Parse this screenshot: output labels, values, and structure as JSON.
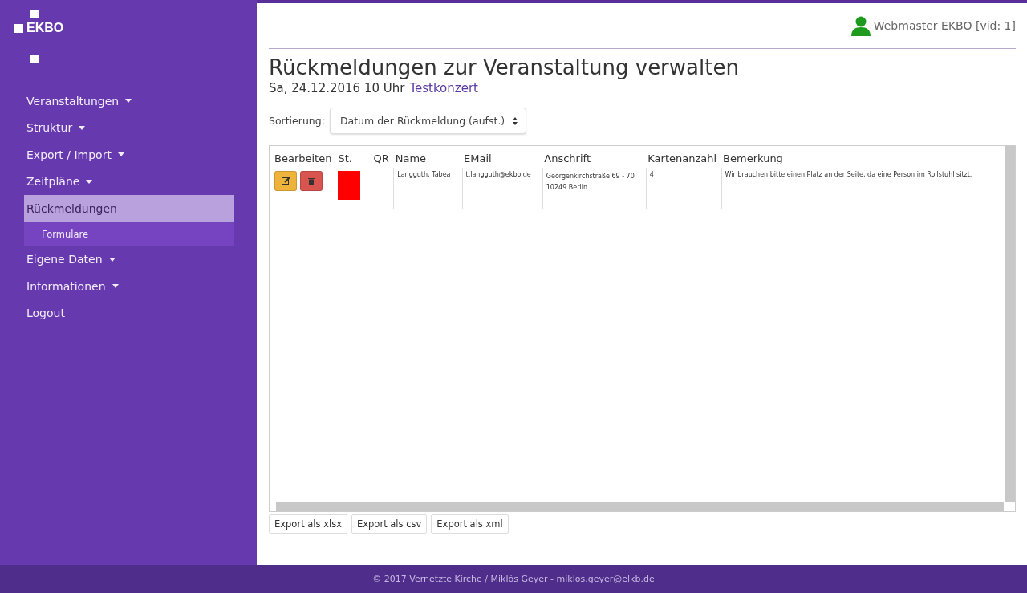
{
  "logo": {
    "text": "EKBO"
  },
  "sidebar": {
    "items": [
      {
        "label": "Veranstaltungen",
        "dropdown": true,
        "selected": false
      },
      {
        "label": "Struktur",
        "dropdown": true,
        "selected": false
      },
      {
        "label": "Export / Import",
        "dropdown": true,
        "selected": false
      },
      {
        "label": "Zeitpläne",
        "dropdown": true,
        "selected": false
      },
      {
        "label": "Rückmeldungen",
        "dropdown": false,
        "selected": true,
        "children": [
          {
            "label": "Formulare",
            "selected": false
          }
        ]
      },
      {
        "label": "Eigene Daten",
        "dropdown": true,
        "selected": false
      },
      {
        "label": "Informationen",
        "dropdown": true,
        "selected": false
      },
      {
        "label": "Logout",
        "dropdown": false,
        "selected": false
      }
    ]
  },
  "user": {
    "name": "Webmaster EKBO [vid: 1]"
  },
  "page": {
    "title": "Rückmeldungen zur Veranstaltung verwalten",
    "event_date": "Sa, 24.12.2016 10 Uhr",
    "event_link": "Testkonzert"
  },
  "sort": {
    "label": "Sortierung:",
    "value": "Datum der Rückmeldung (aufst.)"
  },
  "table": {
    "columns": [
      "Bearbeiten",
      "St.",
      "QR",
      "Name",
      "EMail",
      "Anschrift",
      "Kartenanzahl",
      "Bemerkung"
    ],
    "rows": [
      {
        "color": "#ff0000",
        "name": "Langguth, Tabea",
        "email": "t.langguth@ekbo.de",
        "address": [
          "Georgenkirchstraße 69 - 70",
          "10249 Berlin"
        ],
        "tickets": "4",
        "remark": "Wir brauchen bitte einen Platz an der Seite, da eine Person im Rollstuhl sitzt."
      }
    ]
  },
  "export_buttons": [
    "Export als xlsx",
    "Export als csv",
    "Export als xml"
  ],
  "footer": "© 2017 Vernetzte Kirche / Miklós Geyer - miklos.geyer@elkb.de"
}
